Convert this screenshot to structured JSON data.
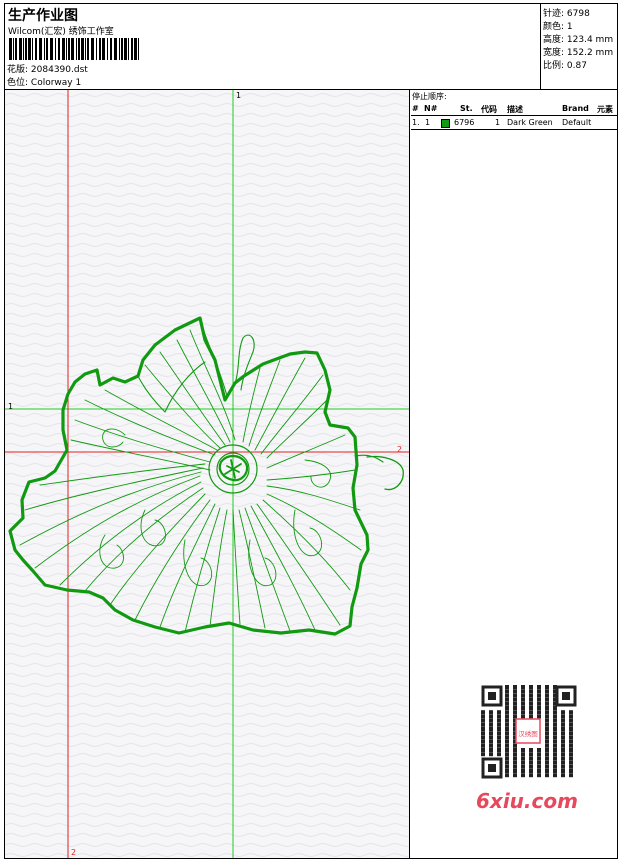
{
  "header": {
    "title": "生产作业图",
    "company": "Wilcom(汇宏) 绣饰工作室",
    "design_label": "花版:",
    "design_value": "2084390.dst",
    "colorway_label": "色位:",
    "colorway_value": "Colorway 1"
  },
  "stats": {
    "stitches_label": "针迹:",
    "stitches_value": "6798",
    "colors_label": "颜色:",
    "colors_value": "1",
    "height_label": "高度:",
    "height_value": "123.4 mm",
    "width_label": "宽度:",
    "width_value": "152.2 mm",
    "scale_label": "比例:",
    "scale_value": "0.87"
  },
  "canvas": {
    "guide_labels": {
      "green_v": "1",
      "green_h": "1",
      "red_h": "2",
      "red_v": "2"
    },
    "colors": {
      "background": "#f6f6f8",
      "stitch": "#119a11",
      "guide_green": "#22cc22",
      "guide_red": "#dd2222"
    }
  },
  "stop_sequence": {
    "title": "停止顺序:",
    "columns": [
      "#",
      "N#",
      "St.",
      "代码",
      "描述",
      "Brand",
      "元素"
    ],
    "rows": [
      {
        "index": "1.",
        "n": "1",
        "stitches": "6796",
        "code": "1",
        "description": "Dark Green",
        "brand": "Default",
        "element": "",
        "color": "#119a11"
      }
    ]
  },
  "watermark": {
    "text": "6xiu.com",
    "qr_center": "汉绣图"
  }
}
